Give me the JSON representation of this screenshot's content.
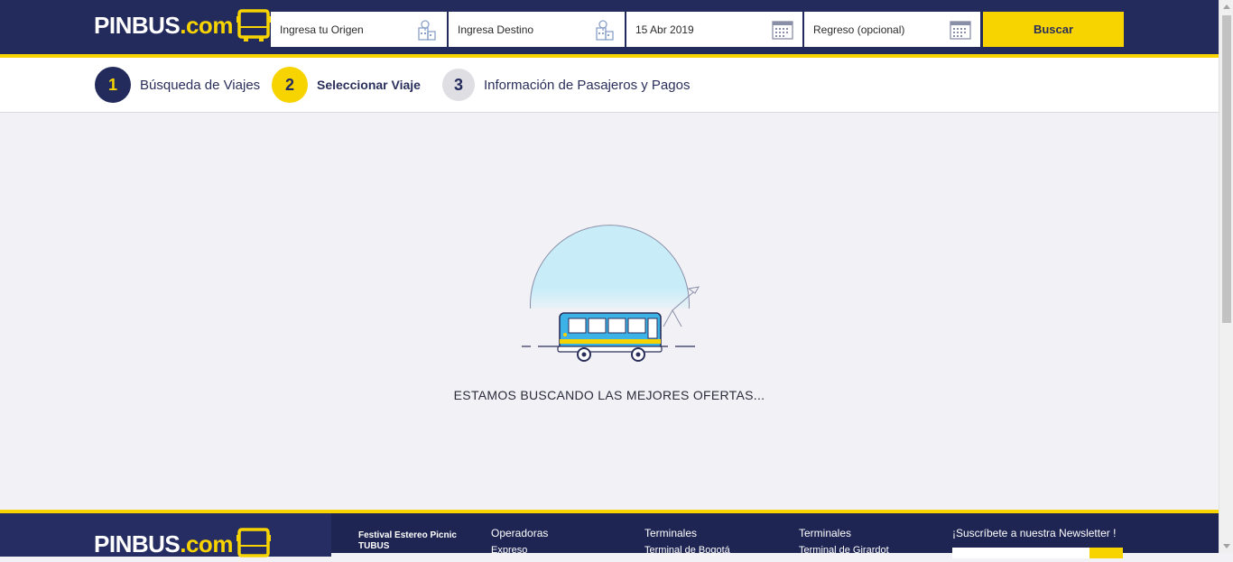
{
  "brand": {
    "logo_main": "PINBUS",
    "logo_suffix": ".com",
    "primary_color": "#232a5c",
    "accent_color": "#f7d300"
  },
  "search": {
    "origin": {
      "value": "Ingresa tu Origen",
      "icon": "map-building-icon"
    },
    "destination": {
      "value": "Ingresa Destino",
      "icon": "map-building-icon"
    },
    "departure": {
      "value": "15 Abr 2019",
      "icon": "calendar-icon"
    },
    "return": {
      "value": "Regreso (opcional)",
      "icon": "calendar-icon"
    },
    "button_label": "Buscar"
  },
  "steps": [
    {
      "number": "1",
      "label": "Búsqueda de Viajes",
      "state": "done"
    },
    {
      "number": "2",
      "label": "Seleccionar Viaje",
      "state": "active"
    },
    {
      "number": "3",
      "label": "Información de Pasajeros y Pagos",
      "state": "pending"
    }
  ],
  "loading": {
    "message": "ESTAMOS BUSCANDO LAS MEJORES OFERTAS..."
  },
  "footer": {
    "promo": {
      "line1": "Festival Estereo Picnic",
      "line2": "TUBUS"
    },
    "columns": [
      {
        "title": "Operadoras",
        "first_item": "Expreso"
      },
      {
        "title": "Terminales",
        "first_item": "Terminal de Bogotá"
      },
      {
        "title": "Terminales",
        "first_item": "Terminal de Girardot"
      }
    ],
    "newsletter": {
      "title": "¡Suscríbete a nuestra Newsletter !"
    }
  }
}
